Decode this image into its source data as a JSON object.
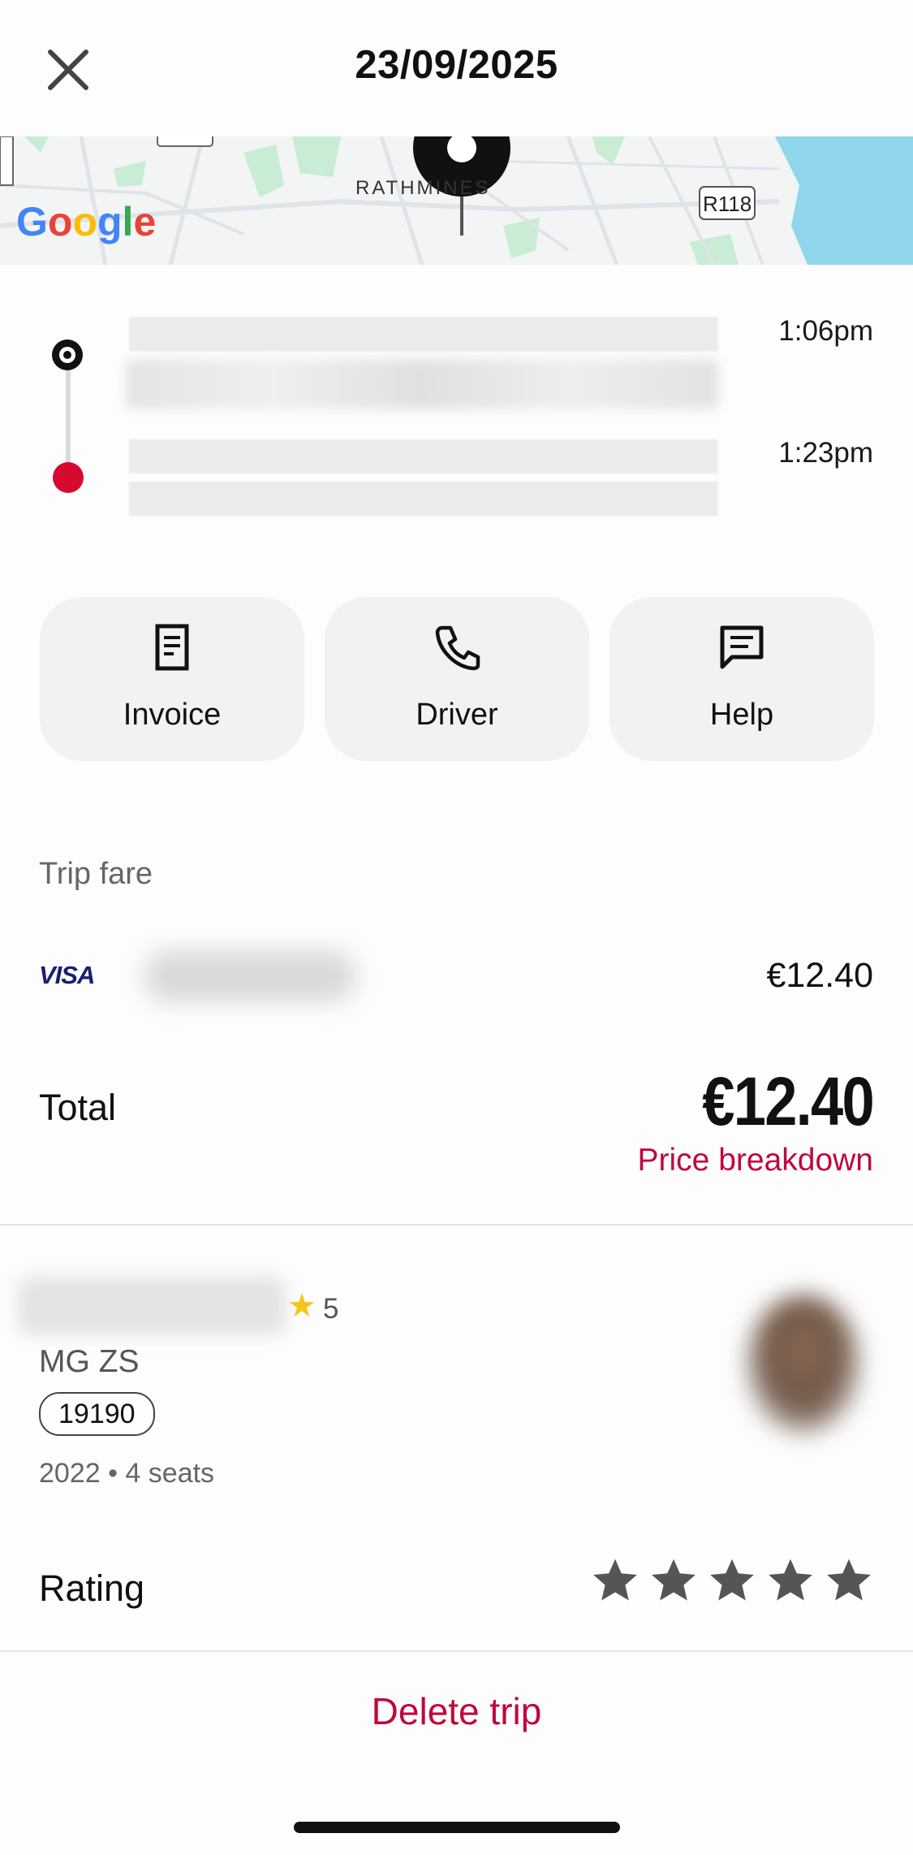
{
  "header": {
    "title": "23/09/2025",
    "close_icon": "close-icon"
  },
  "map": {
    "logo_text": "Google",
    "area_label": "RATHMINES",
    "road_label": "R118"
  },
  "route": {
    "pickup_time": "1:06pm",
    "dropoff_time": "1:23pm"
  },
  "actions": [
    {
      "label": "Invoice",
      "icon": "document-icon"
    },
    {
      "label": "Driver",
      "icon": "phone-icon"
    },
    {
      "label": "Help",
      "icon": "chat-icon"
    }
  ],
  "fare": {
    "section_title": "Trip fare",
    "card_brand": "VISA",
    "amount": "€12.40",
    "total_label": "Total",
    "total_amount": "€12.40",
    "breakdown_link": "Price breakdown"
  },
  "driver": {
    "rating": "5",
    "car_model": "MG ZS",
    "plate": "19190",
    "car_meta": "2022 • 4 seats"
  },
  "rating": {
    "label": "Rating",
    "stars_total": 5,
    "stars_selected": 0
  },
  "footer": {
    "delete_label": "Delete trip"
  },
  "colors": {
    "accent": "#c0083b",
    "dropoff_dot": "#d8092f",
    "button_bg": "#f2f2f2",
    "star_gray": "#555555",
    "star_gold": "#f5c518"
  }
}
